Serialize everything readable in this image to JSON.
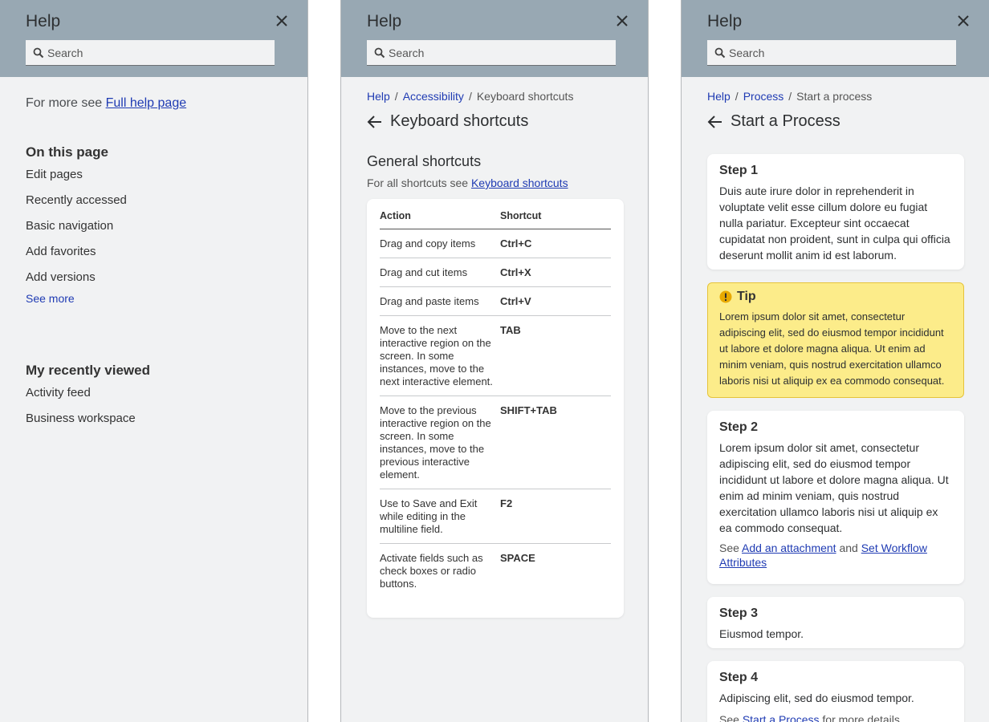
{
  "panel1": {
    "title": "Help",
    "search_placeholder": "Search",
    "more_prefix": "For more see",
    "more_link": "Full help page",
    "on_this_page": "On this page",
    "items": [
      "Edit pages",
      "Recently accessed",
      "Basic navigation",
      "Add favorites",
      "Add versions"
    ],
    "see_more": "See more",
    "recent_heading": "My recently viewed",
    "recent_items": [
      "Activity feed",
      "Business workspace"
    ]
  },
  "panel2": {
    "title": "Help",
    "search_placeholder": "Search",
    "crumbs": [
      "Help",
      "Accessibility",
      "Keyboard shortcuts"
    ],
    "page_title": "Keyboard shortcuts",
    "section_title": "General shortcuts",
    "sub_prefix": "For all shortcuts see",
    "sub_link": "Keyboard shortcuts",
    "table": {
      "headers": [
        "Action",
        "Shortcut"
      ],
      "rows": [
        [
          "Drag and copy items",
          "Ctrl+C"
        ],
        [
          "Drag and cut items",
          "Ctrl+X"
        ],
        [
          "Drag and paste items",
          "Ctrl+V"
        ],
        [
          "Move to the next interactive region on the screen. In some instances, move to the next interactive element.",
          "TAB"
        ],
        [
          "Move to the previous interactive region on the screen. In some instances, move to the previous interactive element.",
          "SHIFT+TAB"
        ],
        [
          "Use to Save and Exit while editing in the multiline field.",
          "F2"
        ],
        [
          "Activate fields such as check boxes or radio buttons.",
          "SPACE"
        ]
      ]
    }
  },
  "panel3": {
    "title": "Help",
    "search_placeholder": "Search",
    "crumbs": [
      "Help",
      "Process",
      "Start a process"
    ],
    "page_title": "Start a Process",
    "step1": {
      "title": "Step 1",
      "text": "Duis aute irure dolor in reprehenderit in voluptate velit esse cillum dolore eu fugiat nulla pariatur. Excepteur sint occaecat cupidatat non proident, sunt in culpa qui officia deserunt mollit anim id est laborum."
    },
    "tip": {
      "title": "Tip",
      "text": "Lorem ipsum dolor sit amet, consectetur adipiscing elit, sed do eiusmod tempor incididunt ut labore et dolore magna aliqua. Ut enim ad minim veniam, quis nostrud exercitation ullamco laboris nisi ut aliquip ex ea commodo consequat."
    },
    "step2": {
      "title": "Step 2",
      "text": "Lorem ipsum dolor sit amet, consectetur adipiscing elit, sed do eiusmod tempor incididunt ut labore et dolore magna aliqua. Ut enim ad minim veniam, quis nostrud exercitation ullamco laboris nisi ut aliquip ex ea commodo consequat.",
      "see_prefix": "See",
      "link1": "Add an attachment",
      "and": "and",
      "link2": "Set Workflow Attributes"
    },
    "step3": {
      "title": "Step 3",
      "text": "Eiusmod tempor."
    },
    "step4": {
      "title": "Step 4",
      "text": "Adipiscing elit, sed do eiusmod tempor.",
      "see_prefix": "See",
      "link": "Start a Process",
      "suffix": "for more details."
    }
  },
  "colors": {
    "header": "#98a8b3",
    "panel_bg": "#f1f2f3",
    "link": "#1f3bb3",
    "tip_bg": "#fcec8a"
  },
  "icons": [
    "search-icon",
    "close-icon",
    "back-arrow-icon",
    "warning-icon"
  ]
}
